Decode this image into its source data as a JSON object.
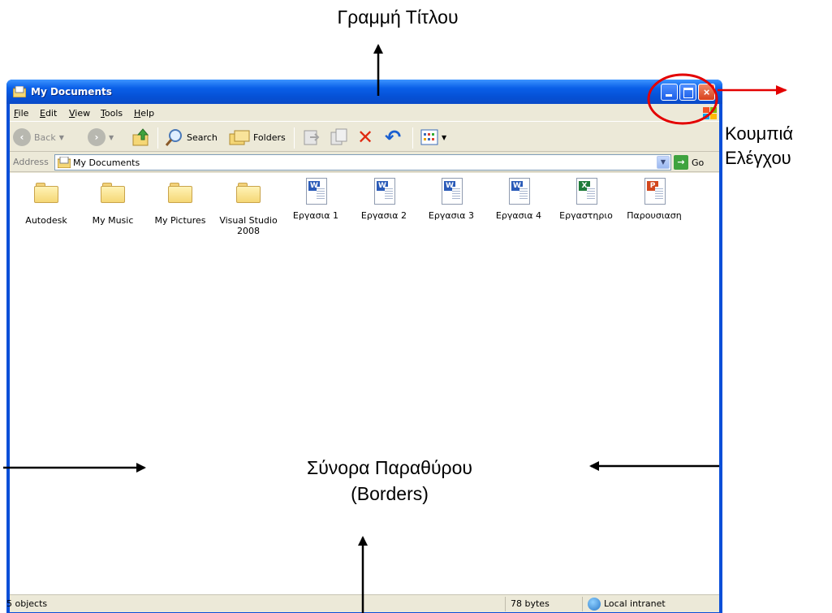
{
  "annotations": {
    "title_bar": "Γραμμή Τίτλου",
    "control_buttons": [
      "Κουμπιά",
      "Ελέγχου"
    ],
    "borders": [
      "Σύνορα Παραθύρου",
      "(Borders)"
    ]
  },
  "colors": {
    "annotation_arrow": "#000000",
    "highlight_circle": "#e30000",
    "titlebar": "#0a5fe8",
    "window_border": "#0a4fd8"
  },
  "window": {
    "title": "My Documents",
    "title_icon": "my-documents-icon",
    "controls": {
      "minimize": "minimize-icon",
      "maximize": "maximize-icon",
      "close": "×"
    }
  },
  "menu": {
    "items": [
      "File",
      "Edit",
      "View",
      "Tools",
      "Help"
    ]
  },
  "toolbar": {
    "back": {
      "label": "Back",
      "icon": "back-arrow-icon"
    },
    "forward": {
      "icon": "forward-arrow-icon"
    },
    "up": {
      "icon": "up-folder-icon"
    },
    "search": {
      "label": "Search",
      "icon": "search-icon"
    },
    "folders": {
      "label": "Folders",
      "icon": "folders-icon"
    },
    "move_to": {
      "icon": "move-to-icon"
    },
    "copy_to": {
      "icon": "copy-to-icon"
    },
    "delete": {
      "icon": "delete-icon",
      "glyph": "✕"
    },
    "undo": {
      "icon": "undo-icon",
      "glyph": "↶"
    },
    "views": {
      "icon": "views-icon"
    }
  },
  "address": {
    "label": "Address",
    "value": "My Documents",
    "go_label": "Go",
    "go_glyph": "→",
    "dropdown_glyph": "▼"
  },
  "files": [
    {
      "name": "Autodesk",
      "type": "folder"
    },
    {
      "name": "My Music",
      "type": "folder"
    },
    {
      "name": "My Pictures",
      "type": "folder"
    },
    {
      "name": "Visual Studio 2008",
      "type": "folder"
    },
    {
      "name": "Εργασια 1",
      "type": "word"
    },
    {
      "name": "Εργασια 2",
      "type": "word"
    },
    {
      "name": "Εργασια 3",
      "type": "word"
    },
    {
      "name": "Εργασια 4",
      "type": "word"
    },
    {
      "name": "Εργαστηριο",
      "type": "excel"
    },
    {
      "name": "Παρουσιαση",
      "type": "powerpoint"
    }
  ],
  "file_badges": {
    "word": "W",
    "excel": "X",
    "powerpoint": "P"
  },
  "status": {
    "objects": "5 objects",
    "size": "78 bytes",
    "zone": "Local intranet"
  }
}
